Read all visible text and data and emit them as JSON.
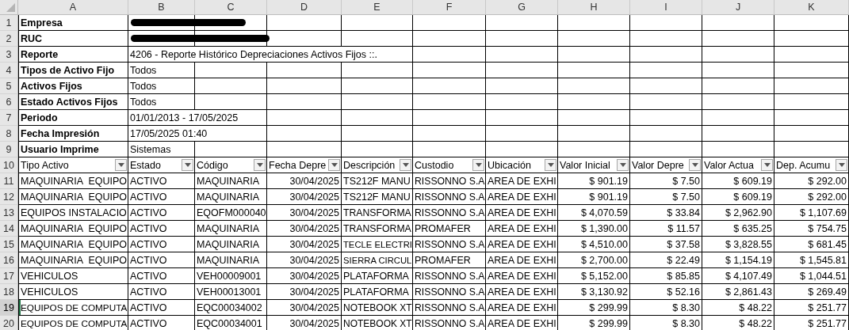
{
  "column_headers": [
    "A",
    "B",
    "C",
    "D",
    "E",
    "F",
    "G",
    "H",
    "I",
    "J",
    "K"
  ],
  "rows": [
    {
      "number": "1",
      "selected": false,
      "cells": [
        {
          "kind": "label",
          "text": "Empresa"
        },
        {
          "kind": "redacted"
        }
      ]
    },
    {
      "number": "2",
      "selected": false,
      "cells": [
        {
          "kind": "label",
          "text": "RUC"
        },
        {
          "kind": "redacted"
        }
      ]
    },
    {
      "number": "3",
      "selected": false,
      "cells": [
        {
          "kind": "label",
          "text": "Reporte"
        },
        {
          "kind": "text",
          "text": "4206 - Reporte Histórico Depreciaciones Activos Fijos ::."
        }
      ]
    },
    {
      "number": "4",
      "selected": false,
      "cells": [
        {
          "kind": "label",
          "text": "Tipos de Activo Fijo"
        },
        {
          "kind": "text",
          "text": "Todos"
        }
      ]
    },
    {
      "number": "5",
      "selected": false,
      "cells": [
        {
          "kind": "label",
          "text": "Activos Fijos"
        },
        {
          "kind": "text",
          "text": "Todos"
        }
      ]
    },
    {
      "number": "6",
      "selected": false,
      "cells": [
        {
          "kind": "label",
          "text": "Estado Activos Fijos"
        },
        {
          "kind": "text",
          "text": "Todos"
        }
      ]
    },
    {
      "number": "7",
      "selected": false,
      "cells": [
        {
          "kind": "label",
          "text": "Periodo"
        },
        {
          "kind": "text",
          "text": "01/01/2013 - 17/05/2025"
        }
      ]
    },
    {
      "number": "8",
      "selected": false,
      "cells": [
        {
          "kind": "label",
          "text": "Fecha Impresión"
        },
        {
          "kind": "text",
          "text": "17/05/2025 01:40"
        }
      ]
    },
    {
      "number": "9",
      "selected": false,
      "cells": [
        {
          "kind": "label",
          "text": "Usuario Imprime"
        },
        {
          "kind": "text",
          "text": "Sistemas"
        }
      ]
    },
    {
      "number": "10",
      "selected": false,
      "cells": [
        {
          "kind": "header",
          "text": "Tipo Activo"
        },
        {
          "kind": "header",
          "text": "Estado"
        },
        {
          "kind": "header",
          "text": "Código"
        },
        {
          "kind": "header",
          "text": "Fecha Depre"
        },
        {
          "kind": "header",
          "text": "Descripción"
        },
        {
          "kind": "header",
          "text": "Custodio"
        },
        {
          "kind": "header",
          "text": "Ubicación"
        },
        {
          "kind": "header",
          "text": "Valor Inicial"
        },
        {
          "kind": "header",
          "text": "Valor Depre"
        },
        {
          "kind": "header",
          "text": "Valor Actua"
        },
        {
          "kind": "header",
          "text": "Dep. Acumu"
        }
      ]
    },
    {
      "number": "11",
      "selected": false,
      "cells": [
        {
          "kind": "text",
          "text": "MAQUINARIA  EQUIPO"
        },
        {
          "kind": "text",
          "text": "ACTIVO"
        },
        {
          "kind": "text",
          "text": "MAQUINARIA"
        },
        {
          "kind": "number",
          "text": "30/04/2025"
        },
        {
          "kind": "text",
          "text": "TS212F MANU"
        },
        {
          "kind": "text",
          "text": "RISSONNO S.A"
        },
        {
          "kind": "text",
          "text": "AREA DE EXHI"
        },
        {
          "kind": "number",
          "text": "$ 901.19"
        },
        {
          "kind": "number",
          "text": "$ 7.50"
        },
        {
          "kind": "number",
          "text": "$ 609.19"
        },
        {
          "kind": "number",
          "text": "$ 292.00"
        }
      ]
    },
    {
      "number": "12",
      "selected": false,
      "cells": [
        {
          "kind": "text",
          "text": "MAQUINARIA  EQUIPO"
        },
        {
          "kind": "text",
          "text": "ACTIVO"
        },
        {
          "kind": "text",
          "text": "MAQUINARIA"
        },
        {
          "kind": "number",
          "text": "30/04/2025"
        },
        {
          "kind": "text",
          "text": "TS212F MANU"
        },
        {
          "kind": "text",
          "text": "RISSONNO S.A"
        },
        {
          "kind": "text",
          "text": "AREA DE EXHI"
        },
        {
          "kind": "number",
          "text": "$ 901.19"
        },
        {
          "kind": "number",
          "text": "$ 7.50"
        },
        {
          "kind": "number",
          "text": "$ 609.19"
        },
        {
          "kind": "number",
          "text": "$ 292.00"
        }
      ]
    },
    {
      "number": "13",
      "selected": false,
      "cells": [
        {
          "kind": "text",
          "text": "EQUIPOS INSTALACIO"
        },
        {
          "kind": "text",
          "text": "ACTIVO"
        },
        {
          "kind": "text",
          "text": "EQOFM000040"
        },
        {
          "kind": "number",
          "text": "30/04/2025"
        },
        {
          "kind": "text",
          "text": "TRANSFORMA"
        },
        {
          "kind": "text",
          "text": "RISSONNO S.A"
        },
        {
          "kind": "text",
          "text": "AREA DE EXHI"
        },
        {
          "kind": "number",
          "text": "$ 4,070.59"
        },
        {
          "kind": "number",
          "text": "$ 33.84"
        },
        {
          "kind": "number",
          "text": "$ 2,962.90"
        },
        {
          "kind": "number",
          "text": "$ 1,107.69"
        }
      ]
    },
    {
      "number": "14",
      "selected": false,
      "cells": [
        {
          "kind": "text",
          "text": "MAQUINARIA  EQUIPO"
        },
        {
          "kind": "text",
          "text": "ACTIVO"
        },
        {
          "kind": "text",
          "text": "MAQUINARIA"
        },
        {
          "kind": "number",
          "text": "30/04/2025"
        },
        {
          "kind": "text",
          "text": "TRANSFORMA"
        },
        {
          "kind": "text",
          "text": "PROMAFER"
        },
        {
          "kind": "text",
          "text": "AREA DE EXHI"
        },
        {
          "kind": "number",
          "text": "$ 1,390.00"
        },
        {
          "kind": "number",
          "text": "$ 11.57"
        },
        {
          "kind": "number",
          "text": "$ 635.25"
        },
        {
          "kind": "number",
          "text": "$ 754.75"
        }
      ]
    },
    {
      "number": "15",
      "selected": false,
      "cells": [
        {
          "kind": "text",
          "text": "MAQUINARIA  EQUIPO"
        },
        {
          "kind": "text",
          "text": "ACTIVO"
        },
        {
          "kind": "text",
          "text": "MAQUINARIA"
        },
        {
          "kind": "number",
          "text": "30/04/2025"
        },
        {
          "kind": "text",
          "text": "TECLE ELECTRI"
        },
        {
          "kind": "text",
          "text": "RISSONNO S.A"
        },
        {
          "kind": "text",
          "text": "AREA DE EXHI"
        },
        {
          "kind": "number",
          "text": "$ 4,510.00"
        },
        {
          "kind": "number",
          "text": "$ 37.58"
        },
        {
          "kind": "number",
          "text": "$ 3,828.55"
        },
        {
          "kind": "number",
          "text": "$ 681.45"
        }
      ]
    },
    {
      "number": "16",
      "selected": false,
      "cells": [
        {
          "kind": "text",
          "text": "MAQUINARIA  EQUIPO"
        },
        {
          "kind": "text",
          "text": "ACTIVO"
        },
        {
          "kind": "text",
          "text": "MAQUINARIA"
        },
        {
          "kind": "number",
          "text": "30/04/2025"
        },
        {
          "kind": "text",
          "text": "SIERRA CIRCUL"
        },
        {
          "kind": "text",
          "text": "PROMAFER"
        },
        {
          "kind": "text",
          "text": "AREA DE EXHI"
        },
        {
          "kind": "number",
          "text": "$ 2,700.00"
        },
        {
          "kind": "number",
          "text": "$ 22.49"
        },
        {
          "kind": "number",
          "text": "$ 1,154.19"
        },
        {
          "kind": "number",
          "text": "$ 1,545.81"
        }
      ]
    },
    {
      "number": "17",
      "selected": false,
      "cells": [
        {
          "kind": "text",
          "text": "VEHICULOS"
        },
        {
          "kind": "text",
          "text": "ACTIVO"
        },
        {
          "kind": "text",
          "text": "VEH00009001"
        },
        {
          "kind": "number",
          "text": "30/04/2025"
        },
        {
          "kind": "text",
          "text": "PLATAFORMA"
        },
        {
          "kind": "text",
          "text": "RISSONNO S.A"
        },
        {
          "kind": "text",
          "text": "AREA DE EXHI"
        },
        {
          "kind": "number",
          "text": "$ 5,152.00"
        },
        {
          "kind": "number",
          "text": "$ 85.85"
        },
        {
          "kind": "number",
          "text": "$ 4,107.49"
        },
        {
          "kind": "number",
          "text": "$ 1,044.51"
        }
      ]
    },
    {
      "number": "18",
      "selected": false,
      "cells": [
        {
          "kind": "text",
          "text": "VEHICULOS"
        },
        {
          "kind": "text",
          "text": "ACTIVO"
        },
        {
          "kind": "text",
          "text": "VEH00013001"
        },
        {
          "kind": "number",
          "text": "30/04/2025"
        },
        {
          "kind": "text",
          "text": "PLATAFORMA"
        },
        {
          "kind": "text",
          "text": "RISSONNO S.A"
        },
        {
          "kind": "text",
          "text": "AREA DE EXHI"
        },
        {
          "kind": "number",
          "text": "$ 3,130.92"
        },
        {
          "kind": "number",
          "text": "$ 52.16"
        },
        {
          "kind": "number",
          "text": "$ 2,861.43"
        },
        {
          "kind": "number",
          "text": "$ 269.49"
        }
      ]
    },
    {
      "number": "19",
      "selected": true,
      "cells": [
        {
          "kind": "text",
          "text": "EQUIPOS DE COMPUTA"
        },
        {
          "kind": "text",
          "text": "ACTIVO"
        },
        {
          "kind": "text",
          "text": "EQC00034002"
        },
        {
          "kind": "number",
          "text": "30/04/2025"
        },
        {
          "kind": "text",
          "text": "NOTEBOOK XT"
        },
        {
          "kind": "text",
          "text": "RISSONNO S.A"
        },
        {
          "kind": "text",
          "text": "AREA DE EXHI"
        },
        {
          "kind": "number",
          "text": "$ 299.99"
        },
        {
          "kind": "number",
          "text": "$ 8.30"
        },
        {
          "kind": "number",
          "text": "$ 48.22"
        },
        {
          "kind": "number",
          "text": "$ 251.77"
        }
      ]
    },
    {
      "number": "20",
      "selected": false,
      "cells": [
        {
          "kind": "text",
          "text": "EQUIPOS DE COMPUTA"
        },
        {
          "kind": "text",
          "text": "ACTIVO"
        },
        {
          "kind": "text",
          "text": "EQC00034001"
        },
        {
          "kind": "number",
          "text": "30/04/2025"
        },
        {
          "kind": "text",
          "text": "NOTEBOOK XT"
        },
        {
          "kind": "text",
          "text": "RISSONNO S.A"
        },
        {
          "kind": "text",
          "text": "AREA DE EXHI"
        },
        {
          "kind": "number",
          "text": "$ 299.99"
        },
        {
          "kind": "number",
          "text": "$ 8.30"
        },
        {
          "kind": "number",
          "text": "$ 48.22"
        },
        {
          "kind": "number",
          "text": "$ 251.77"
        }
      ]
    }
  ]
}
